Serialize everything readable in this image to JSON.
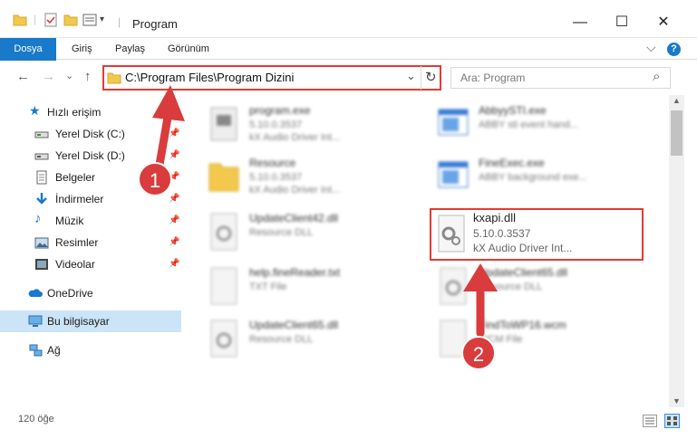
{
  "window": {
    "title": "Program",
    "minimize_glyph": "—",
    "maximize_glyph": "☐",
    "close_glyph": "✕",
    "help_glyph": "?",
    "collapse_glyph": "⌵"
  },
  "ribbon": {
    "tabs": [
      "Dosya",
      "Giriş",
      "Paylaş",
      "Görünüm"
    ],
    "accent": "#1979ca"
  },
  "nav": {
    "back_glyph": "←",
    "forward_glyph": "→",
    "recent_glyph": "⌄",
    "up_glyph": "↑"
  },
  "address": {
    "path": "C:\\Program Files\\Program Dizini",
    "dropdown_glyph": "⌄",
    "refresh_glyph": "↻"
  },
  "search": {
    "placeholder": "Ara: Program",
    "icon": "search-icon",
    "glyph": "⌕"
  },
  "sidebar": {
    "items": [
      {
        "label": "Hızlı erişim",
        "icon": "star-icon",
        "pinned": false
      },
      {
        "label": "Yerel Disk (C:)",
        "icon": "drive-icon",
        "pinned": true
      },
      {
        "label": "Yerel Disk (D:)",
        "icon": "drive-icon",
        "pinned": true
      },
      {
        "label": "Belgeler",
        "icon": "documents-icon",
        "pinned": true
      },
      {
        "label": "İndirmeler",
        "icon": "download-icon",
        "pinned": true
      },
      {
        "label": "Müzik",
        "icon": "music-icon",
        "pinned": true
      },
      {
        "label": "Resimler",
        "icon": "pictures-icon",
        "pinned": true
      },
      {
        "label": "Videolar",
        "icon": "video-icon",
        "pinned": true
      },
      {
        "label": "OneDrive",
        "icon": "cloud-icon",
        "pinned": false
      },
      {
        "label": "Bu bilgisayar",
        "icon": "computer-icon",
        "pinned": false
      },
      {
        "label": "Ağ",
        "icon": "network-icon",
        "pinned": false
      }
    ],
    "pin_glyph": "📌"
  },
  "files": [
    {
      "name": "program.exe",
      "line2": "5.10.0.3537",
      "line3": "kX Audio Driver Int...",
      "icon": "exe-icon"
    },
    {
      "name": "AbbyySTI.exe",
      "line2": "ABBY sti event hand...",
      "line3": "",
      "icon": "app-window-icon"
    },
    {
      "name": "Resource",
      "line2": "5.10.0.3537",
      "line3": "kX Audio Driver Int...",
      "icon": "folder-icon"
    },
    {
      "name": "FineExec.exe",
      "line2": "ABBY background exe...",
      "line3": "",
      "icon": "app-window-icon"
    },
    {
      "name": "UpdateClient42.dll",
      "line2": "Resource DLL",
      "line3": "",
      "icon": "dll-icon"
    },
    {
      "name": "kxapi.dll",
      "line2": "5.10.0.3537",
      "line3": "kX Audio Driver Int...",
      "icon": "dll-gear-icon"
    },
    {
      "name": "help.fineReader.txt",
      "line2": "TXT File",
      "line3": "",
      "icon": "text-file-icon"
    },
    {
      "name": "UpdateClient65.dll",
      "line2": "Resource DLL",
      "line3": "",
      "icon": "dll-icon"
    },
    {
      "name": "UpdateClient65.dll",
      "line2": "Resource DLL",
      "line3": "",
      "icon": "dll-icon"
    },
    {
      "name": "FindToWP16.wcm",
      "line2": "WCM File",
      "line3": "",
      "icon": "file-icon"
    }
  ],
  "status": {
    "count": "120 öğe"
  },
  "annotations": {
    "step1": "1",
    "step2": "2",
    "color": "#d93c3c"
  }
}
